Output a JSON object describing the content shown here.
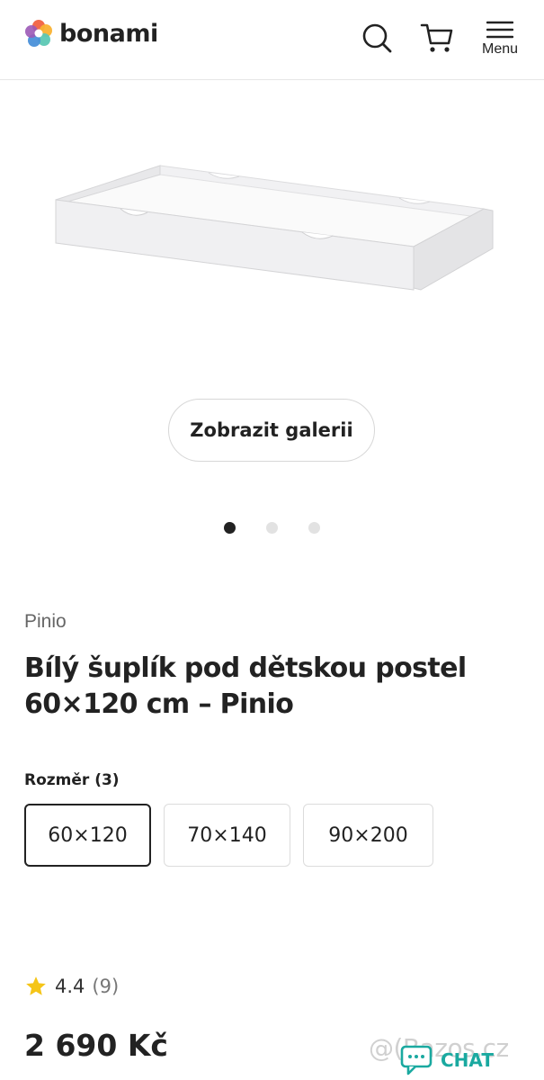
{
  "header": {
    "brand_name": "bonami",
    "menu_label": "Menu"
  },
  "gallery": {
    "button_label": "Zobrazit galerii",
    "slides_total": 3,
    "active_slide": 1
  },
  "product": {
    "brand": "Pinio",
    "title": "Bílý šuplík pod dětskou postel 60×120 cm – Pinio",
    "size_label": "Rozměr (3)",
    "sizes": [
      "60×120",
      "70×140",
      "90×200"
    ],
    "selected_size": "60×120",
    "rating": "4.4",
    "rating_count": "(9)",
    "price": "2 690 Kč"
  },
  "overlay": {
    "watermark": "@(Bazos.cz",
    "chat_label": "CHAT"
  },
  "colors": {
    "text": "#222222",
    "muted": "#666666",
    "star": "#f5c518",
    "chat": "#1aa9a0"
  }
}
